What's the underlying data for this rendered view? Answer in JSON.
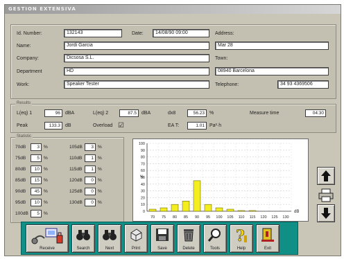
{
  "window": {
    "title": "GESTION EXTENSIVA"
  },
  "record": {
    "id_label": "Id. Number:",
    "id_value": "132143",
    "date_label": "Date:",
    "date_value": "14/08/90 09:00",
    "name_label": "Name:",
    "name_value": "Jordi Garcia",
    "company_label": "Company:",
    "company_value": "Dicsosa S.L.",
    "department_label": "Department",
    "department_value": "HD",
    "work_label": "Work:",
    "work_value": "Speaker Tester",
    "address_label": "Address:",
    "address_value": "Mar 28",
    "town_label": "Town:",
    "town_value": "08940 Barcelona",
    "telephone_label": "Telephone:",
    "telephone_value": "34 93 4369506"
  },
  "results": {
    "group_label": "Results",
    "leq1_label": "L(eq) 1",
    "leq1_value": "96",
    "leq1_unit": "dBA",
    "leq2_label": "L(eq) 2",
    "leq2_value": "87.5",
    "leq2_unit": "dBA",
    "dose_label": "dx8",
    "dose_value": "56.23",
    "dose_unit": "%",
    "time_label": "Measure time",
    "time_value": "04:30",
    "peak_label": "Peak",
    "peak_value": "133.3",
    "peak_unit": "dB",
    "overload_label": "Overload",
    "overload_check": "☑",
    "ea_label": "EA T:",
    "ea_value": "1.01",
    "ea_unit": "Pa²·h"
  },
  "statistic": {
    "group_label": "Statistic",
    "left": [
      {
        "label": "70dB",
        "value": "3",
        "unit": "%"
      },
      {
        "label": "75dB",
        "value": "5",
        "unit": "%"
      },
      {
        "label": "80dB",
        "value": "10",
        "unit": "%"
      },
      {
        "label": "85dB",
        "value": "15",
        "unit": "%"
      },
      {
        "label": "90dB",
        "value": "45",
        "unit": "%"
      },
      {
        "label": "95dB",
        "value": "10",
        "unit": "%"
      },
      {
        "label": "100dB",
        "value": "5",
        "unit": "%"
      }
    ],
    "right": [
      {
        "label": "105dB",
        "value": "3",
        "unit": "%"
      },
      {
        "label": "110dB",
        "value": "1",
        "unit": "%"
      },
      {
        "label": "115dB",
        "value": "1",
        "unit": "%"
      },
      {
        "label": "120dB",
        "value": "0",
        "unit": "%"
      },
      {
        "label": "125dB",
        "value": "0",
        "unit": "%"
      },
      {
        "label": "130dB",
        "value": "0",
        "unit": "%"
      }
    ]
  },
  "chart_data": {
    "type": "bar",
    "categories": [
      "70",
      "75",
      "80",
      "85",
      "90",
      "95",
      "100",
      "105",
      "110",
      "115",
      "120",
      "125",
      "130"
    ],
    "values": [
      3,
      5,
      10,
      15,
      45,
      10,
      5,
      3,
      1,
      1,
      0,
      0,
      0
    ],
    "ylabel": "%",
    "xlabel": "dB",
    "ylim": [
      0,
      100
    ],
    "yticks": [
      "0",
      "10",
      "20",
      "30",
      "40",
      "50",
      "60",
      "70",
      "80",
      "90",
      "100"
    ],
    "grid": true,
    "bar_color": "#f4ee1e"
  },
  "side_buttons": [
    {
      "name": "scroll-up-button",
      "icon": "up-arrow-icon"
    },
    {
      "name": "print-preview-button",
      "icon": "printer-icon"
    },
    {
      "name": "scroll-down-button",
      "icon": "down-arrow-icon"
    }
  ],
  "toolbar": {
    "receive": "Receive",
    "search": "Search",
    "next": "Next",
    "print": "Print",
    "save": "Save",
    "delete": "Delete",
    "tools": "Tools",
    "help": "Help",
    "exit": "Exit"
  },
  "colors": {
    "window_bg": "#c9c6b8",
    "toolbar_bg": "#0f8f86",
    "bar": "#f4ee1e",
    "arrow": "#111111"
  }
}
